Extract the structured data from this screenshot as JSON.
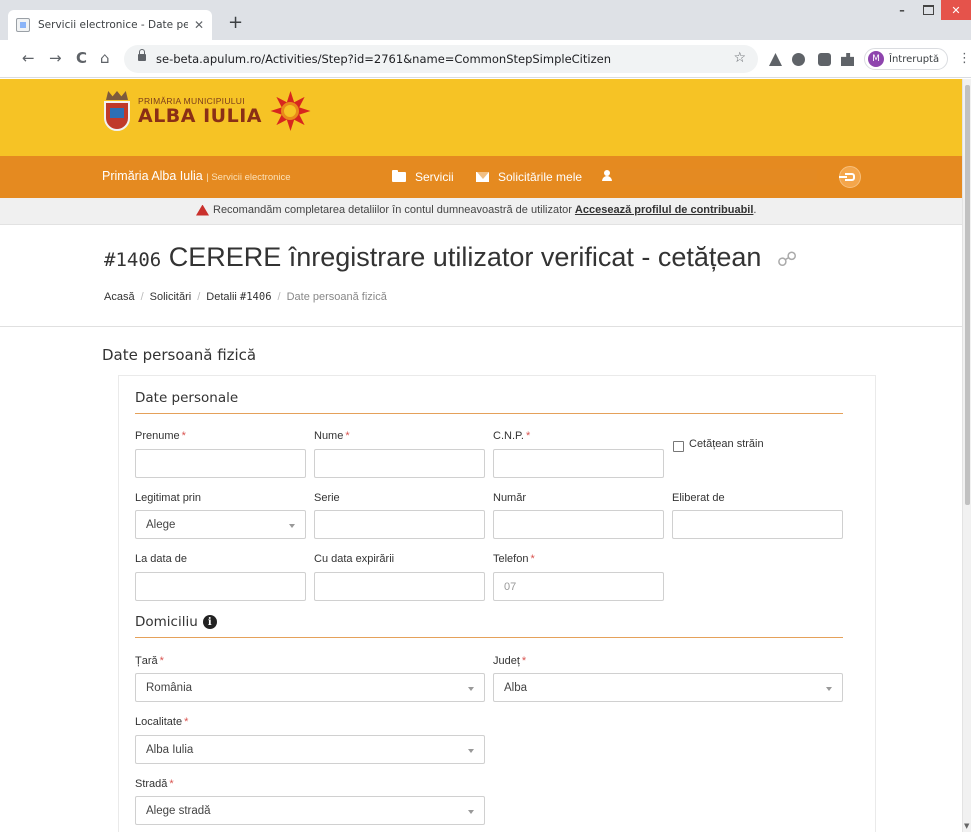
{
  "browser": {
    "tab_title": "Servicii electronice - Date persoa",
    "tab_close": "✕",
    "new_tab": "+",
    "url": "se-beta.apulum.ro/Activities/Step?id=2761&name=CommonStepSimpleCitizen",
    "profile_initial": "M",
    "profile_label": "Întreruptă",
    "back": "←",
    "forward": "→",
    "reload": "C",
    "home": "⌂",
    "star": "☆",
    "menu": "⋮",
    "win_min": "–",
    "win_close": "✕"
  },
  "header": {
    "logo_line1": "PRIMĂRIA MUNICIPIULUI",
    "logo_line2": "ALBA IULIA"
  },
  "navbar": {
    "brand": "Primăria Alba Iulia",
    "brand_sub": "| Servicii electronice",
    "services": "Servicii",
    "requests": "Solicitările mele"
  },
  "alert": {
    "text": "Recomandăm completarea detaliilor în contul dumneavoastră de utilizator",
    "link": "Accesează profilul de contribuabil",
    "tail": "."
  },
  "page": {
    "title_num": "#1406",
    "title": "CERERE înregistrare utilizator verificat - cetățean",
    "link_glyph": "🔗",
    "breadcrumb": {
      "home": "Acasă",
      "requests": "Solicitări",
      "details_prefix": "Detalii ",
      "details_num": "#1406",
      "current": "Date persoană fizică",
      "sep": "/"
    }
  },
  "form": {
    "section_title": "Date persoană fizică",
    "personal": {
      "heading": "Date personale",
      "first_name": {
        "label": "Prenume",
        "value": ""
      },
      "last_name": {
        "label": "Nume",
        "value": ""
      },
      "cnp": {
        "label": "C.N.P.",
        "value": ""
      },
      "foreign": {
        "label": "Cetățean străin",
        "checked": false
      },
      "id_type": {
        "label": "Legitimat prin",
        "value": "Alege"
      },
      "series": {
        "label": "Serie",
        "value": ""
      },
      "number": {
        "label": "Număr",
        "value": ""
      },
      "issued_by": {
        "label": "Eliberat de",
        "value": ""
      },
      "issue_date": {
        "label": "La data de",
        "value": ""
      },
      "expiry_date": {
        "label": "Cu data expirării",
        "value": ""
      },
      "phone": {
        "label": "Telefon",
        "placeholder": "07"
      },
      "required_mark": "*"
    },
    "address": {
      "heading": "Domiciliu",
      "info_glyph": "i",
      "country": {
        "label": "Țară",
        "value": "România"
      },
      "county": {
        "label": "Județ",
        "value": "Alba"
      },
      "city": {
        "label": "Localitate",
        "value": "Alba Iulia"
      },
      "street": {
        "label": "Stradă",
        "value": "Alege stradă"
      }
    }
  },
  "colors": {
    "header_yellow": "#f6c325",
    "nav_orange": "#e58a20",
    "required_red": "#d9534f",
    "rule_orange": "#e5a15a"
  }
}
